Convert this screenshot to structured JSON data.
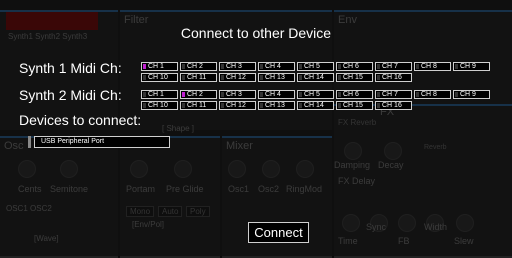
{
  "dialog": {
    "title": "Connect to other Device",
    "synth1_label": "Synth 1 Midi Ch:",
    "synth2_label": "Synth 2 Midi Ch:",
    "devices_label": "Devices to connect:",
    "synth1_channels": [
      "CH 1",
      "CH 2",
      "CH 3",
      "CH 4",
      "CH 5",
      "CH 6",
      "CH 7",
      "CH 8",
      "CH 9",
      "CH 10",
      "CH 11",
      "CH 12",
      "CH 13",
      "CH 14",
      "CH 15",
      "CH 16"
    ],
    "synth2_channels": [
      "CH 1",
      "CH 2",
      "CH 3",
      "CH 4",
      "CH 5",
      "CH 6",
      "CH 7",
      "CH 8",
      "CH 9",
      "CH 10",
      "CH 11",
      "CH 12",
      "CH 13",
      "CH 14",
      "CH 15",
      "CH 16"
    ],
    "synth1_selected": "CH 1",
    "synth2_selected": "CH 2",
    "devices": [
      "USB Peripheral Port"
    ],
    "connect_label": "Connect",
    "selected_color": "#c020d0"
  },
  "background": {
    "tabs_text": "Synth1 Synth2 Synth3",
    "filter_label": "Filter",
    "env_label": "Env",
    "osc_label": "Osc",
    "mixer_label": "Mixer",
    "fx_label": "FX",
    "cents_label": "Cents",
    "semitone_label": "Semitone",
    "portam_label": "Portam",
    "preglide_label": "Pre Glide",
    "osc1_label": "Osc1",
    "osc2_label": "Osc2",
    "ringmod_label": "RingMod",
    "damping_label": "Damping",
    "decay_label": "Decay",
    "fxdelay_label": "FX Delay",
    "time_label": "Time",
    "fb_label": "FB",
    "width_label": "Width",
    "slew_label": "Slew",
    "shape_label": "[ Shape ]",
    "fxreverb_label": "FX Reverb",
    "reverb_label": "Reverb",
    "sync_label": "Sync",
    "mono_label": "Mono",
    "auto_label": "Auto",
    "poly_label": "Poly",
    "wave_label": "[Wave]",
    "osc12_label": "OSC1 OSC2",
    "env_mode_label": "[Env/Pol]"
  }
}
